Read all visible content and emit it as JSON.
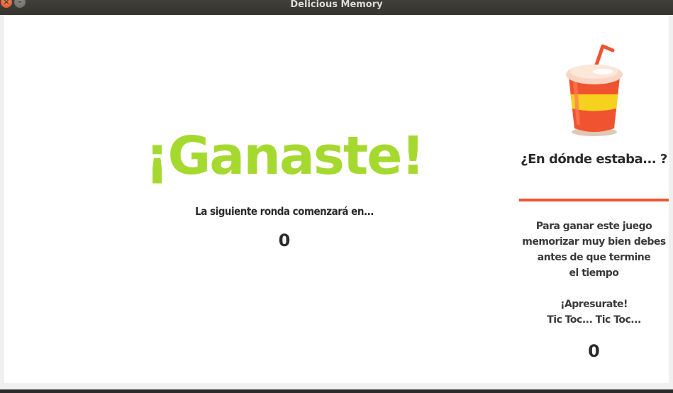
{
  "window": {
    "title": "Delicious Memory",
    "close_glyph": "×",
    "minimize_glyph": "–"
  },
  "main": {
    "result_title": "¡Ganaste!",
    "next_round_text": "La siguiente ronda comenzará en...",
    "countdown": "0"
  },
  "sidebar": {
    "title": "¿En dónde estaba... ?",
    "instructions": [
      "Para ganar este juego",
      "memorizar muy bien debes",
      "antes de que termine",
      "el tiempo"
    ],
    "hurry": [
      "¡Apresurate!",
      "Tic Toc... Tic Toc..."
    ],
    "timer": "0"
  },
  "colors": {
    "accent_green": "#a6d930",
    "accent_red": "#f0532f",
    "cup_yellow": "#f6d21f",
    "text_dark": "#2b2b2b"
  }
}
